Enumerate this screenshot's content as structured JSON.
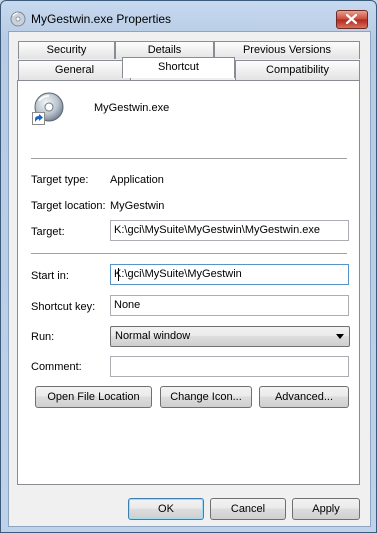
{
  "window": {
    "title": "MyGestwin.exe Properties"
  },
  "tabs": {
    "row1": [
      "Security",
      "Details",
      "Previous Versions"
    ],
    "row2": [
      "General",
      "Shortcut",
      "Compatibility"
    ],
    "active": "Shortcut"
  },
  "shortcut": {
    "name": "MyGestwin.exe",
    "target_type_label": "Target type:",
    "target_type_value": "Application",
    "target_location_label": "Target location:",
    "target_location_value": "MyGestwin",
    "target_label": "Target:",
    "target_value": "K:\\gci\\MySuite\\MyGestwin\\MyGestwin.exe",
    "start_in_label": "Start in:",
    "start_in_value": "K:\\gci\\MySuite\\MyGestwin",
    "shortcut_key_label": "Shortcut key:",
    "shortcut_key_value": "None",
    "run_label": "Run:",
    "run_value": "Normal window",
    "comment_label": "Comment:",
    "comment_value": "",
    "open_file_location_label": "Open File Location",
    "change_icon_label": "Change Icon...",
    "advanced_label": "Advanced..."
  },
  "footer": {
    "ok_label": "OK",
    "cancel_label": "Cancel",
    "apply_label": "Apply"
  },
  "icons": {
    "app_icon": "cd-disc-icon",
    "shortcut_overlay": "shortcut-arrow-icon",
    "close": "close-icon"
  }
}
